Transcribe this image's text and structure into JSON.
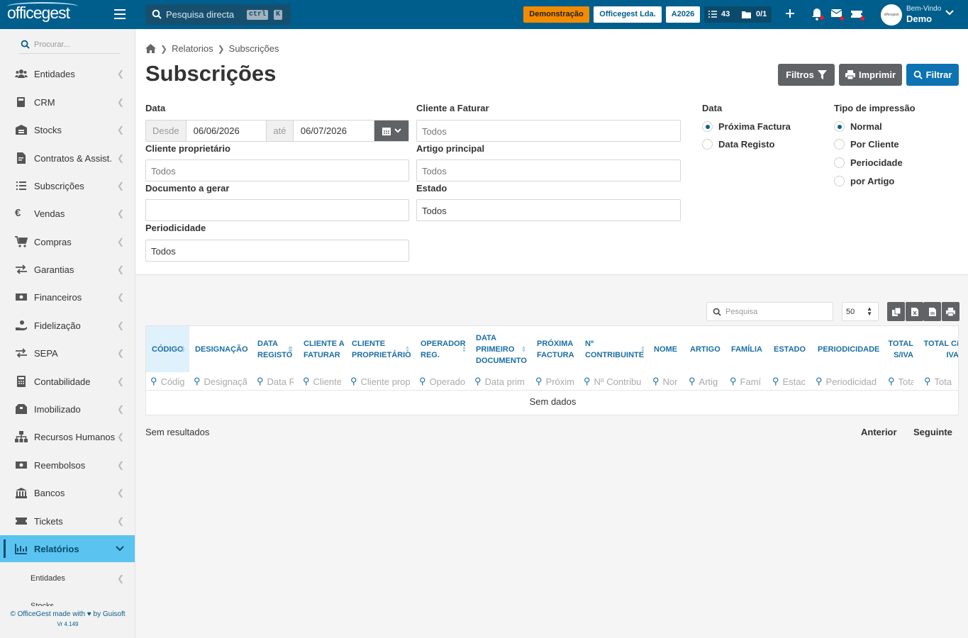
{
  "topbar": {
    "logo": "officegest",
    "search_placeholder": "Pesquisa directa",
    "shortcut_ctrl": "ctrl",
    "shortcut_key": "K",
    "badge_demo": "Demonstração",
    "company": "Officegest Lda.",
    "year": "A2026",
    "tasks_count": "43",
    "messages_count": "0/1",
    "user_greeting": "Bem-Vindo",
    "user_name": "Demo",
    "avatar_text": "officegest"
  },
  "sidebar": {
    "search_placeholder": "Procurar...",
    "items": [
      {
        "label": "Entidades",
        "icon": "users-icon"
      },
      {
        "label": "CRM",
        "icon": "book-icon"
      },
      {
        "label": "Stocks",
        "icon": "warehouse-icon"
      },
      {
        "label": "Contratos & Assist.",
        "icon": "file-contract-icon"
      },
      {
        "label": "Subscrições",
        "icon": "list-icon"
      },
      {
        "label": "Vendas",
        "icon": "euro-icon"
      },
      {
        "label": "Compras",
        "icon": "cart-icon"
      },
      {
        "label": "Garantias",
        "icon": "exchange-icon"
      },
      {
        "label": "Financeiros",
        "icon": "money-icon"
      },
      {
        "label": "Fidelização",
        "icon": "hand-coin-icon"
      },
      {
        "label": "SEPA",
        "icon": "exchange-icon"
      },
      {
        "label": "Contabilidade",
        "icon": "calculator-icon"
      },
      {
        "label": "Imobilizado",
        "icon": "boxes-icon"
      },
      {
        "label": "Recursos Humanos",
        "icon": "org-chart-icon"
      },
      {
        "label": "Reembolsos",
        "icon": "money-icon"
      },
      {
        "label": "Bancos",
        "icon": "bank-icon"
      },
      {
        "label": "Tickets",
        "icon": "ticket-icon"
      },
      {
        "label": "Relatórios",
        "icon": "chart-icon"
      }
    ],
    "sub_items": [
      "Entidades",
      "Stocks"
    ],
    "footer": "© OfficeGest made with",
    "footer_by": "by Guisoft",
    "version": "Vr 4.149"
  },
  "breadcrumb": {
    "level1": "Relatorios",
    "level2": "Subscrições"
  },
  "page": {
    "title": "Subscrições",
    "btn_filtros": "Filtros",
    "btn_imprimir": "Imprimir",
    "btn_filtrar": "Filtrar"
  },
  "form": {
    "data_label": "Data",
    "desde": "Desde",
    "desde_value": "06/06/2026",
    "ate": "até",
    "ate_value": "06/07/2026",
    "cliente_faturar_label": "Cliente a Faturar",
    "cliente_faturar_value": "Todos",
    "cliente_proprietario_label": "Cliente proprietário",
    "cliente_proprietario_value": "Todos",
    "artigo_principal_label": "Artigo principal",
    "artigo_principal_value": "Todos",
    "documento_gerar_label": "Documento a gerar",
    "documento_gerar_value": "",
    "estado_label": "Estado",
    "estado_value": "Todos",
    "periodicidade_label": "Periodicidade",
    "periodicidade_value": "Todos",
    "data_radio_label": "Data",
    "data_options": [
      "Próxima Factura",
      "Data Registo"
    ],
    "data_selected": 0,
    "tipo_label": "Tipo de impressão",
    "tipo_options": [
      "Normal",
      "Por Cliente",
      "Periocidade",
      "por Artigo"
    ],
    "tipo_selected": 0
  },
  "table": {
    "search_placeholder": "Pesquisa",
    "page_size": "50",
    "columns": [
      {
        "header": "CÓDIGO",
        "filter": "Códig"
      },
      {
        "header": "DESIGNAÇÃO",
        "filter": "Designaçã"
      },
      {
        "header": "DATA REGISTO",
        "filter": "Data R"
      },
      {
        "header": "CLIENTE A FATURAR",
        "filter": "Cliente"
      },
      {
        "header": "CLIENTE PROPRIETÁRIO",
        "filter": "Cliente propr"
      },
      {
        "header": "OPERADOR REG.",
        "filter": "Operado"
      },
      {
        "header": "DATA PRIMEIRO DOCUMENTO",
        "filter": "Data prim"
      },
      {
        "header": "PRÓXIMA FACTURA",
        "filter": "Próxim"
      },
      {
        "header": "Nº CONTRIBUINTE",
        "filter": "Nº Contribu"
      },
      {
        "header": "NOME",
        "filter": "Nor"
      },
      {
        "header": "ARTIGO",
        "filter": "Artig"
      },
      {
        "header": "FAMÍLIA",
        "filter": "Famí"
      },
      {
        "header": "ESTADO",
        "filter": "Estac"
      },
      {
        "header": "PERIODICIDADE",
        "filter": "Periodicidad"
      },
      {
        "header": "TOTAL S/IVA",
        "filter": "Tota"
      },
      {
        "header": "TOTAL C/ IVA",
        "filter": "Tota"
      }
    ],
    "empty_text": "Sem dados",
    "results_text": "Sem resultados",
    "prev": "Anterior",
    "next": "Seguinte"
  }
}
